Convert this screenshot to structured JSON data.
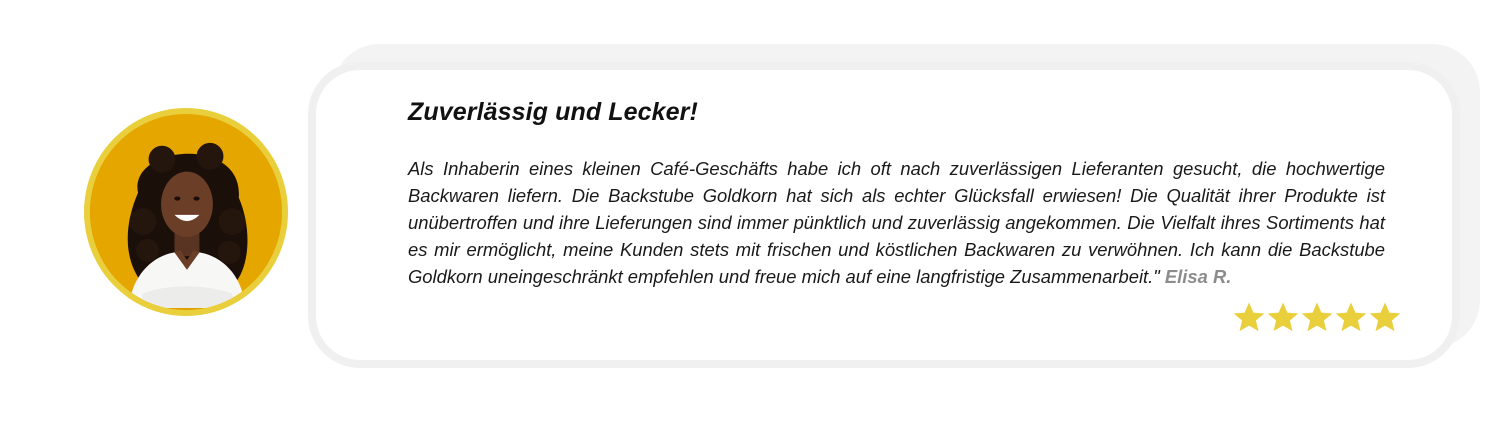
{
  "testimonial": {
    "title": "Zuverlässig und Lecker!",
    "quote": "Als Inhaberin eines kleinen Café-Geschäfts habe ich oft nach zuverlässigen Lieferanten gesucht, die hochwertige Backwaren liefern. Die Backstube Goldkorn hat sich als echter Glücksfall erwiesen! Die Qualität ihrer Produkte ist unübertroffen und ihre Lieferungen sind immer pünktlich und zuverlässig angekommen. Die Vielfalt ihres Sortiments hat es mir ermöglicht, meine Kunden stets mit frischen und köstlichen Backwaren zu verwöhnen. Ich kann die Backstube Goldkorn uneingeschränkt empfehlen und freue mich auf eine langfristige Zusammenarbeit.\"",
    "author": "Elisa R.",
    "rating": 5,
    "rating_max": 5
  },
  "avatar": {
    "icon": "customer-portrait"
  },
  "colors": {
    "accent_gold": "#e9cf3c",
    "avatar_background": "#e6a600",
    "author_gray": "#8c8c8c",
    "card_border": "#f0f0f0"
  }
}
